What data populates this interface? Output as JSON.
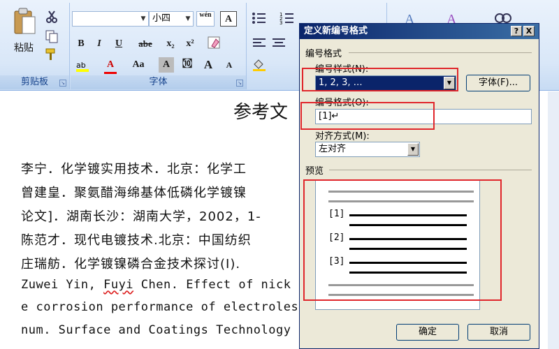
{
  "ribbon": {
    "clipboard": {
      "paste_label": "粘贴",
      "group_label": "剪贴板"
    },
    "font": {
      "font_name": "",
      "font_size": "小四",
      "wen_label": "wén",
      "buttons": [
        "B",
        "I",
        "U",
        "abe",
        "x₂",
        "x²",
        "A",
        "Aa",
        "A",
        "㉈",
        "A",
        "A"
      ],
      "group_label": "字体"
    }
  },
  "document": {
    "title": "参考文",
    "lines": [
      "李宁．化学镀实用技术．北京：化学工",
      "曾建皇．聚氨醋海绵基体低磷化学镀镍",
      "论文]．湖南长沙：湖南大学，2002，1-",
      "陈范才．现代电镀技术.北京：中国纺织",
      "庄瑞舫．化学镀镍磷合金技术探讨(Ⅰ)."
    ],
    "english_lines": [
      {
        "pre": "Zuwei Yin, ",
        "squig": "Fuyi",
        "post": " Chen. Effect of nick"
      },
      {
        "pre": "e corrosion performance of electroless",
        "squig": "",
        "post": ""
      },
      {
        "pre": "num. Surface and Coatings Technology",
        "squig": "",
        "post": ""
      }
    ]
  },
  "dialog": {
    "title": "定义新编号格式",
    "help_label": "?",
    "close_label": "X",
    "section_numbering": "编号格式",
    "style_label": "编号样式(N):",
    "style_value": "1, 2, 3, …",
    "font_button": "字体(F)...",
    "format_label": "编号格式(O):",
    "format_value": "[1]↵",
    "align_label": "对齐方式(M):",
    "align_value": "左对齐",
    "preview_label": "预览",
    "preview_items": [
      "[1]",
      "[2]",
      "[3]"
    ],
    "ok_label": "确定",
    "cancel_label": "取消"
  },
  "colors": {
    "highlight_box": "#e0262b",
    "titlebar": "#0a246a"
  }
}
